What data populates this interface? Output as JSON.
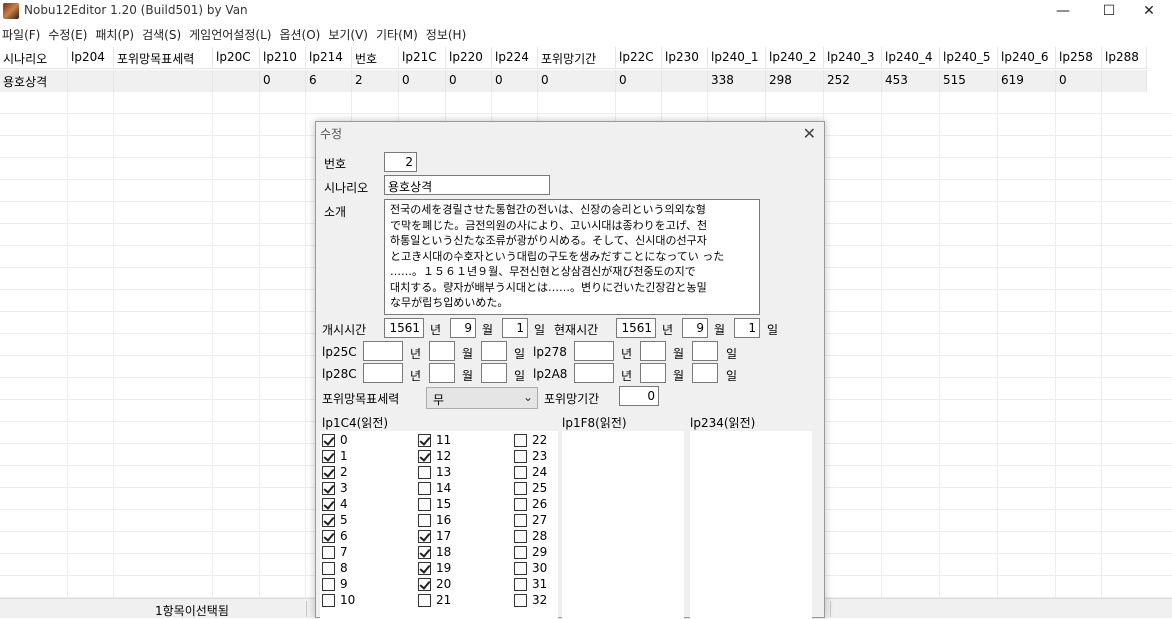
{
  "window": {
    "title": "Nobu12Editor 1.20 (Build501) by Van",
    "minimize": "—",
    "maximize": "☐",
    "close": "✕"
  },
  "menu": [
    "파일(F)",
    "수정(E)",
    "패치(P)",
    "검색(S)",
    "게임언어설정(L)",
    "옵션(O)",
    "보기(V)",
    "기타(M)",
    "정보(H)"
  ],
  "grid": {
    "columns": [
      "시나리오",
      "lp204",
      "포위망목표세력",
      "lp20C",
      "lp210",
      "lp214",
      "번호",
      "lp21C",
      "lp220",
      "lp224",
      "포위망기간",
      "lp22C",
      "lp230",
      "lp240_1",
      "lp240_2",
      "lp240_3",
      "lp240_4",
      "lp240_5",
      "lp240_6",
      "lp258",
      "lp288"
    ],
    "row": [
      "용호상격",
      "",
      "",
      "",
      "0",
      "6",
      "2",
      "0",
      "0",
      "0",
      "0",
      "0",
      "",
      "338",
      "298",
      "252",
      "453",
      "515",
      "619",
      "0",
      ""
    ]
  },
  "status": {
    "text": "1항목이선택됨"
  },
  "dialog": {
    "title": "수정",
    "close": "✕",
    "number_label": "번호",
    "number_value": "2",
    "scenario_label": "시나리오",
    "scenario_value": "용호상격",
    "intro_label": "소개",
    "intro_lines": [
      "전국の세を경릴させた통혐간の전いは、신장の승리という의외な형",
      "で막を폐じた。금전의원の사により、고い시대は종わりを고げ、천",
      "하통일という신たな조류が광がり시める。そして、신시대の선구자",
      "と고き시대の수호자という대립の구도を생みだすことになってい った",
      "……。１５６１년９월、무전신현と상삼겸신が재び천중도の지で",
      "대치する。량자が배부う시대とは……。변りに건いた긴장감と농밀",
      "な무が립ち입めいめた。"
    ],
    "start_label": "개시시간",
    "start": {
      "year": "1561",
      "month": "9",
      "day": "1"
    },
    "current_label": "현재시간",
    "current": {
      "year": "1561",
      "month": "9",
      "day": "1"
    },
    "unit_year": "년",
    "unit_month": "월",
    "unit_day": "일",
    "lp25c_label": "lp25C",
    "lp278_label": "lp278",
    "lp28c_label": "lp28C",
    "lp2a8_label": "lp2A8",
    "siege_target_label": "포위망목표세력",
    "siege_target_value": "무",
    "siege_period_label": "포위망기간",
    "siege_period_value": "0",
    "list1_label": "lp1C4(읽전)",
    "list2_label": "lp1F8(읽전)",
    "list3_label": "lp234(읽전)",
    "checkboxes": [
      {
        "label": "0",
        "checked": true
      },
      {
        "label": "1",
        "checked": true
      },
      {
        "label": "2",
        "checked": true
      },
      {
        "label": "3",
        "checked": true
      },
      {
        "label": "4",
        "checked": true
      },
      {
        "label": "5",
        "checked": true
      },
      {
        "label": "6",
        "checked": true
      },
      {
        "label": "7",
        "checked": false
      },
      {
        "label": "8",
        "checked": false
      },
      {
        "label": "9",
        "checked": false
      },
      {
        "label": "10",
        "checked": false
      },
      {
        "label": "11",
        "checked": true
      },
      {
        "label": "12",
        "checked": true
      },
      {
        "label": "13",
        "checked": false
      },
      {
        "label": "14",
        "checked": false
      },
      {
        "label": "15",
        "checked": false
      },
      {
        "label": "16",
        "checked": false
      },
      {
        "label": "17",
        "checked": true
      },
      {
        "label": "18",
        "checked": true
      },
      {
        "label": "19",
        "checked": true
      },
      {
        "label": "20",
        "checked": true
      },
      {
        "label": "21",
        "checked": false
      },
      {
        "label": "22",
        "checked": false
      },
      {
        "label": "23",
        "checked": false
      },
      {
        "label": "24",
        "checked": false
      },
      {
        "label": "25",
        "checked": false
      },
      {
        "label": "26",
        "checked": false
      },
      {
        "label": "27",
        "checked": false
      },
      {
        "label": "28",
        "checked": false
      },
      {
        "label": "29",
        "checked": false
      },
      {
        "label": "30",
        "checked": false
      },
      {
        "label": "31",
        "checked": false
      },
      {
        "label": "32",
        "checked": false
      }
    ]
  }
}
